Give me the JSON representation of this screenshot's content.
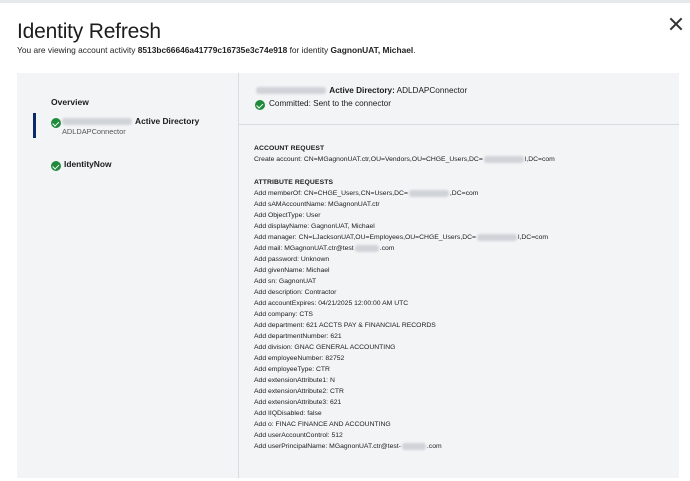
{
  "dialog": {
    "title": "Identity Refresh",
    "subtitle_prefix": "You are viewing account activity ",
    "activity_id": "8513bc66646a41779c16735e3c74e918",
    "subtitle_mid": " for identity ",
    "identity_name": "GagnonUAT, Michael",
    "subtitle_suffix": "."
  },
  "sidebar": {
    "overview_label": "Overview",
    "source_label": "Active Directory",
    "source_sub": "ADLDAPConnector",
    "identitynow_label": "IdentityNow"
  },
  "detail": {
    "source_name": "Active Directory:",
    "connector": " ADLDAPConnector",
    "status": "Committed: Sent to the connector",
    "account_request_title": "ACCOUNT REQUEST",
    "create_account_pre": "Create account: CN=MGagnonUAT.ctr,OU=Vendors,OU=CHGE_Users,DC=",
    "create_account_post": "l,DC=com",
    "attribute_requests_title": "ATTRIBUTE REQUESTS",
    "memberof_pre": "Add memberOf: CN=CHGE_Users,CN=Users,DC=",
    "memberof_post": ",DC=com",
    "manager_pre": "Add manager: CN=LJacksonUAT,OU=Employees,OU=CHGE_Users,DC=",
    "manager_post": "l,DC=com",
    "mail_pre": "Add mail: MGagnonUAT.ctr@test",
    "mail_post": ".com",
    "upn_pre": "Add userPrincipalName: MGagnonUAT.ctr@test-",
    "upn_post": ".com",
    "lines": [
      "Add sAMAccountName: MGagnonUAT.ctr",
      "Add ObjectType: User",
      "Add displayName: GagnonUAT, Michael",
      "Add password: Unknown",
      "Add givenName: Michael",
      "Add sn: GagnonUAT",
      "Add description: Contractor",
      "Add accountExpires: 04/21/2025 12:00:00 AM UTC",
      "Add company: CTS",
      "Add department: 621 ACCTS PAY & FINANCIAL RECORDS",
      "Add departmentNumber: 621",
      "Add division: GNAC GENERAL ACCOUNTING",
      "Add employeeNumber: 82752",
      "Add employeeType: CTR",
      "Add extensionAttribute1: N",
      "Add extensionAttribute2: CTR",
      "Add extensionAttribute3: 621",
      "Add IIQDisabled: false",
      "Add o: FINAC FINANCE AND ACCOUNTING",
      "Add userAccountControl: 512"
    ]
  },
  "colors": {
    "panel_bg": "#f3f4f6",
    "success": "#1f8a3b",
    "active_indicator": "#0b2a6b"
  },
  "icons": [
    "close-icon",
    "check-circle-icon"
  ]
}
